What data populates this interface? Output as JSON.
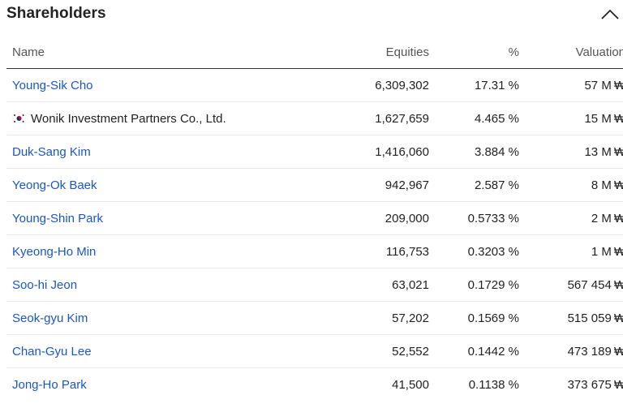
{
  "header": {
    "title": "Shareholders",
    "collapse_icon": "chevron-up-icon"
  },
  "table": {
    "columns": {
      "name": "Name",
      "equities": "Equities",
      "percent": "%",
      "valuation": "Valuation"
    },
    "currency_symbol": "₩",
    "rows": [
      {
        "name": "Young-Sik Cho",
        "equities": "6,309,302",
        "percent": "17.31 %",
        "valuation": "57 M"
      },
      {
        "name": "Wonik Investment Partners Co., Ltd.",
        "flag": "south-korea-flag-icon",
        "equities": "1,627,659",
        "percent": "4.465 %",
        "valuation": "15 M"
      },
      {
        "name": "Duk-Sang Kim",
        "equities": "1,416,060",
        "percent": "3.884 %",
        "valuation": "13 M"
      },
      {
        "name": "Yeong-Ok Baek",
        "equities": "942,967",
        "percent": "2.587 %",
        "valuation": "8 M"
      },
      {
        "name": "Young-Shin Park",
        "equities": "209,000",
        "percent": "0.5733 %",
        "valuation": "2 M"
      },
      {
        "name": "Kyeong-Ho Min",
        "equities": "116,753",
        "percent": "0.3203 %",
        "valuation": "1 M"
      },
      {
        "name": "Soo-hi Jeon",
        "equities": "63,021",
        "percent": "0.1729 %",
        "valuation": "567 454"
      },
      {
        "name": "Seok-gyu Kim",
        "equities": "57,202",
        "percent": "0.1569 %",
        "valuation": "515 059"
      },
      {
        "name": "Chan-Gyu Lee",
        "equities": "52,552",
        "percent": "0.1442 %",
        "valuation": "473 189"
      },
      {
        "name": "Jong-Ho Park",
        "equities": "41,500",
        "percent": "0.1138 %",
        "valuation": "373 675"
      }
    ]
  },
  "colors": {
    "link": "#1a56c8",
    "text": "#222222",
    "header_text": "#555555",
    "row_divider": "#e6e6e6",
    "header_divider": "#333333"
  }
}
